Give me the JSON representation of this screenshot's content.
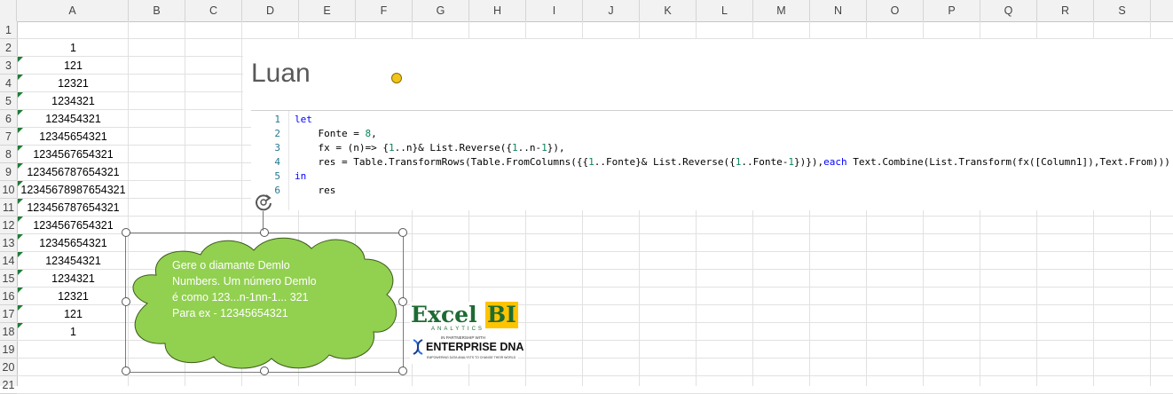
{
  "columns": [
    "A",
    "B",
    "C",
    "D",
    "E",
    "F",
    "G",
    "H",
    "I",
    "J",
    "K",
    "L",
    "M",
    "N",
    "O",
    "P",
    "Q",
    "R",
    "S"
  ],
  "rows": [
    "1",
    "2",
    "3",
    "4",
    "5",
    "6",
    "7",
    "8",
    "9",
    "10",
    "11",
    "12",
    "13",
    "14",
    "15",
    "16",
    "17",
    "18",
    "19",
    "20",
    "21"
  ],
  "column_a_values": [
    "",
    "1",
    "121",
    "12321",
    "1234321",
    "123454321",
    "12345654321",
    "1234567654321",
    "123456787654321",
    "12345678987654321",
    "123456787654321",
    "1234567654321",
    "12345654321",
    "123454321",
    "1234321",
    "12321",
    "121",
    "1",
    "",
    "",
    ""
  ],
  "title": "Luan",
  "code": {
    "line_numbers": [
      "1",
      "2",
      "3",
      "4",
      "5",
      "6"
    ],
    "lines": [
      "let",
      "    Fonte = 8,",
      "    fx = (n)=> {1..n}& List.Reverse({1..n-1}),",
      "    res = Table.TransformRows(Table.FromColumns({{1..Fonte}& List.Reverse({1..Fonte-1})}),each Text.Combine(List.Transform(fx([Column1]),Text.From)))",
      "in",
      "    res"
    ]
  },
  "bubble": {
    "text_lines": [
      "Gere o diamante Demlo",
      "Numbers. Um número Demlo",
      "é como 123...n-1nn-1... 321",
      "Para ex - 12345654321"
    ],
    "fill_color": "#92d050"
  },
  "logo": {
    "excel": "Excel",
    "bi": "BI",
    "analytics": "ANALYTICS",
    "partnership": "IN PARTNERSHIP WITH",
    "enterprise_dna": "ENTERPRISE DNA",
    "tagline": "EMPOWERING DATA ANALYSTS TO CHANGE THEIR WORLD"
  },
  "colors": {
    "accent": "#1e6b34",
    "bi_background": "#ffc400",
    "code_keyword": "#0000ff",
    "code_number": "#098658"
  }
}
